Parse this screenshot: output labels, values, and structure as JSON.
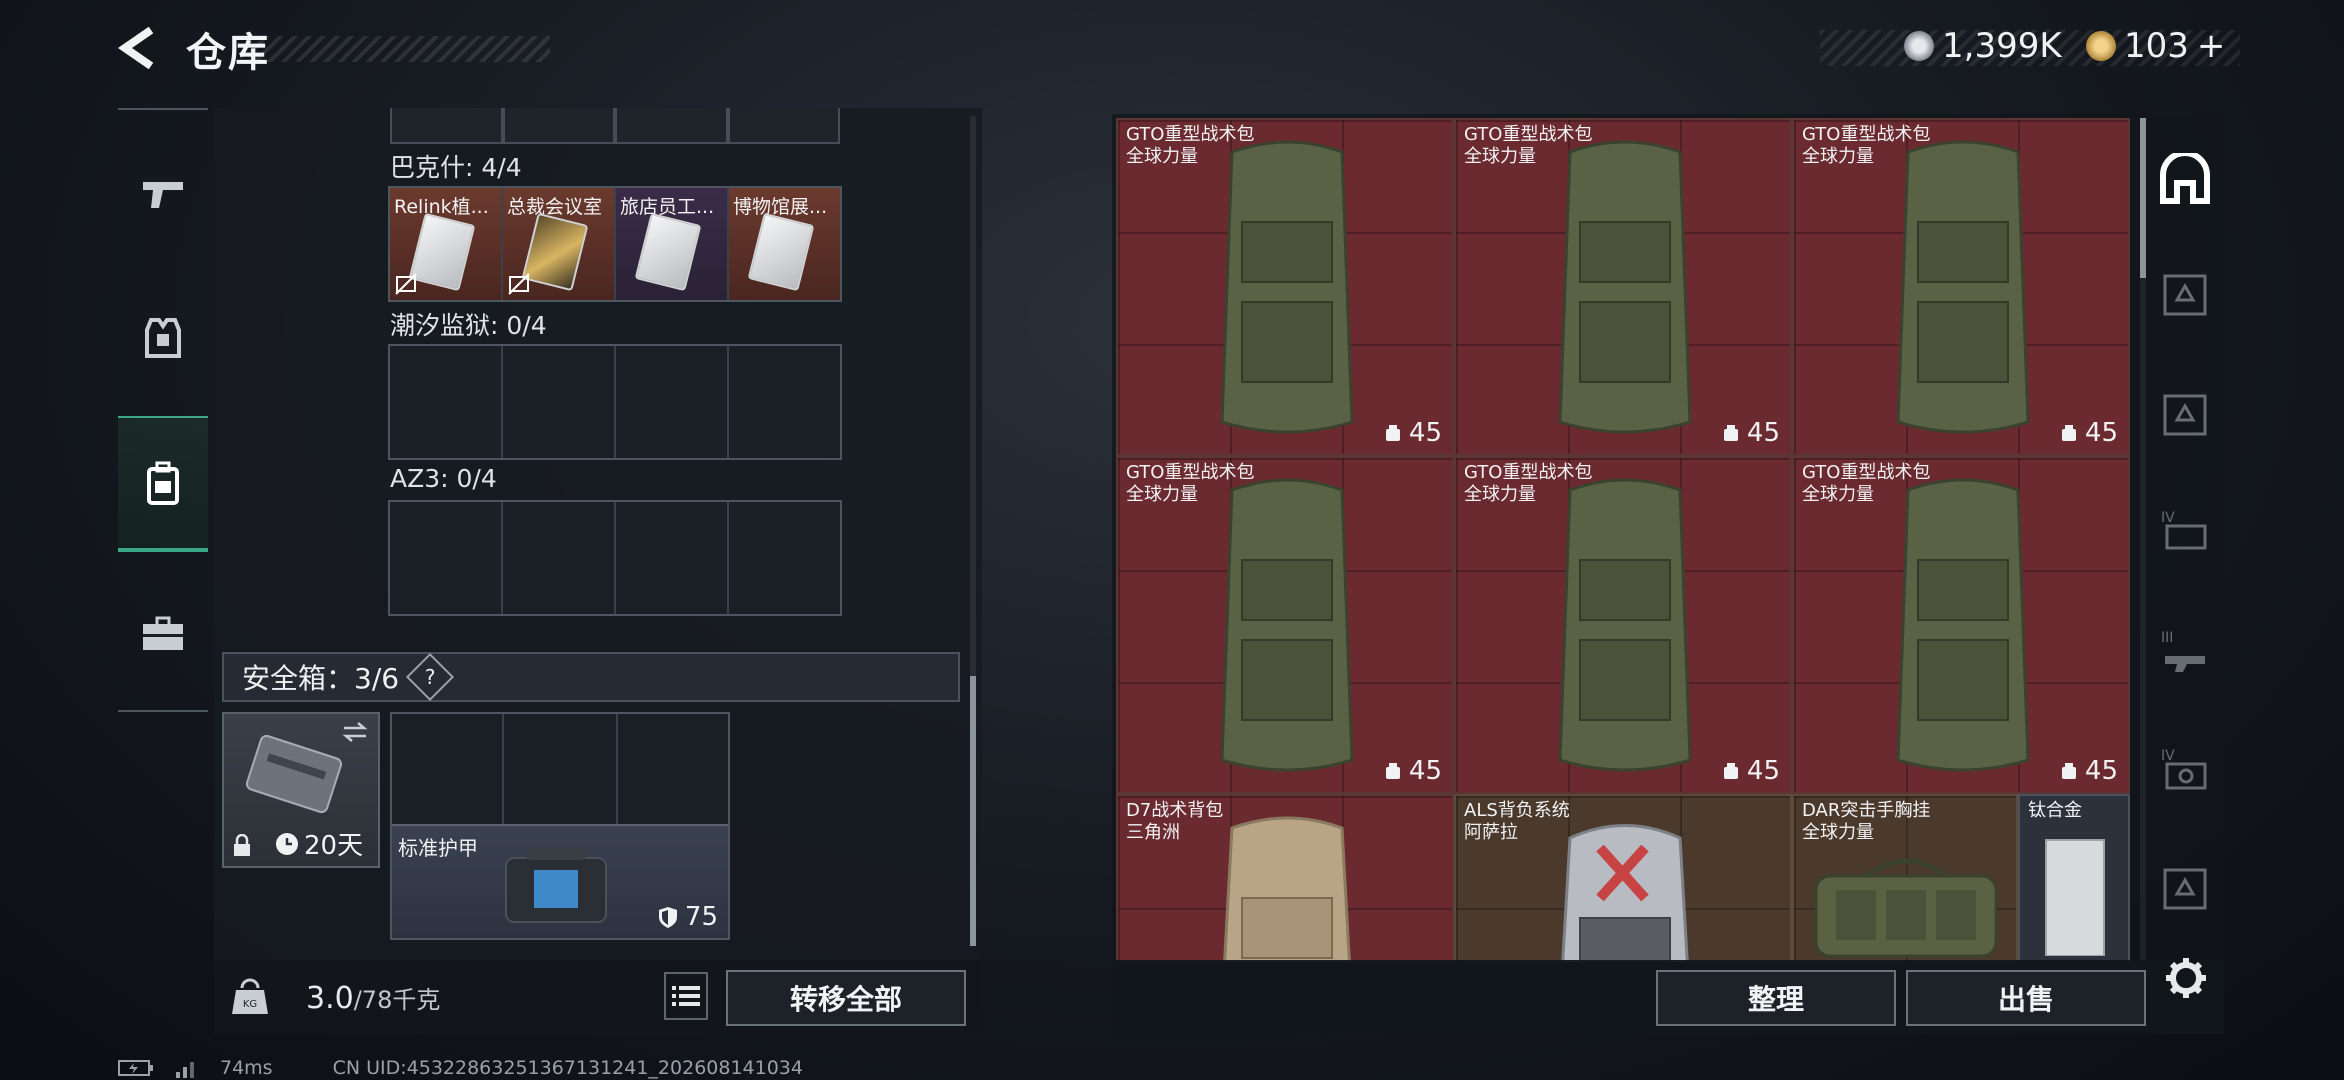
{
  "header": {
    "title": "仓库",
    "currency": [
      {
        "icon": "silver-coin-icon",
        "value": "1,399K"
      },
      {
        "icon": "gold-coin-icon",
        "value": "103",
        "suffix": "+"
      }
    ]
  },
  "left_nav": [
    {
      "icon": "weapon-icon",
      "active": false
    },
    {
      "icon": "armor-vest-icon",
      "active": false
    },
    {
      "icon": "backpack-icon",
      "active": true
    },
    {
      "icon": "briefcase-icon",
      "active": false
    }
  ],
  "keycard_sections": [
    {
      "label": "巴克什: 4/4",
      "slots": [
        {
          "name": "Relink植...",
          "style": "rust",
          "card": "white",
          "locked": true
        },
        {
          "name": "总裁会议室",
          "style": "rust",
          "card": "gold",
          "locked": true
        },
        {
          "name": "旅店员工...",
          "style": "purple",
          "card": "white",
          "locked": false
        },
        {
          "name": "博物馆展...",
          "style": "rust",
          "card": "white",
          "locked": false
        }
      ]
    },
    {
      "label": "潮汐监狱: 0/4",
      "slots": []
    },
    {
      "label": "AZ3: 0/4",
      "slots": []
    }
  ],
  "safebox": {
    "label": "安全箱：3/6",
    "help": "?",
    "duration": "20天",
    "armor_item": {
      "name": "标准护甲",
      "count": "75"
    }
  },
  "weight": {
    "current": "3.0",
    "max": "/78千克"
  },
  "buttons": {
    "transfer_all": "转移全部",
    "organize": "整理",
    "sell": "出售"
  },
  "storage_items": [
    {
      "name": "GTO重型战术包",
      "sub": "全球力量",
      "count": "45"
    },
    {
      "name": "GTO重型战术包",
      "sub": "全球力量",
      "count": "45"
    },
    {
      "name": "GTO重型战术包",
      "sub": "全球力量",
      "count": "45"
    },
    {
      "name": "GTO重型战术包",
      "sub": "全球力量",
      "count": "45"
    },
    {
      "name": "GTO重型战术包",
      "sub": "全球力量",
      "count": "45"
    },
    {
      "name": "GTO重型战术包",
      "sub": "全球力量",
      "count": "45"
    },
    {
      "name": "D7战术背包",
      "sub": "三角洲",
      "count": ""
    },
    {
      "name": "ALS背负系统",
      "sub": "阿萨拉",
      "count": ""
    },
    {
      "name": "DAR突击手胸挂",
      "sub": "全球力量",
      "count": ""
    },
    {
      "name": "钛合金",
      "sub": "",
      "count": ""
    }
  ],
  "right_nav": [
    {
      "icon": "safehouse-icon",
      "active": true
    },
    {
      "icon": "armor-tier-icon",
      "active": false
    },
    {
      "icon": "armor-tier-icon",
      "active": false
    },
    {
      "icon": "weapon-case-iv-icon",
      "active": false
    },
    {
      "icon": "weapon-case-iii-icon",
      "active": false
    },
    {
      "icon": "weapon-case-iv-icon",
      "active": false
    },
    {
      "icon": "armor-tier-icon",
      "active": false
    }
  ],
  "status": {
    "ping": "74ms",
    "uid": "CN UID:45322863251367131241_202608141034"
  }
}
